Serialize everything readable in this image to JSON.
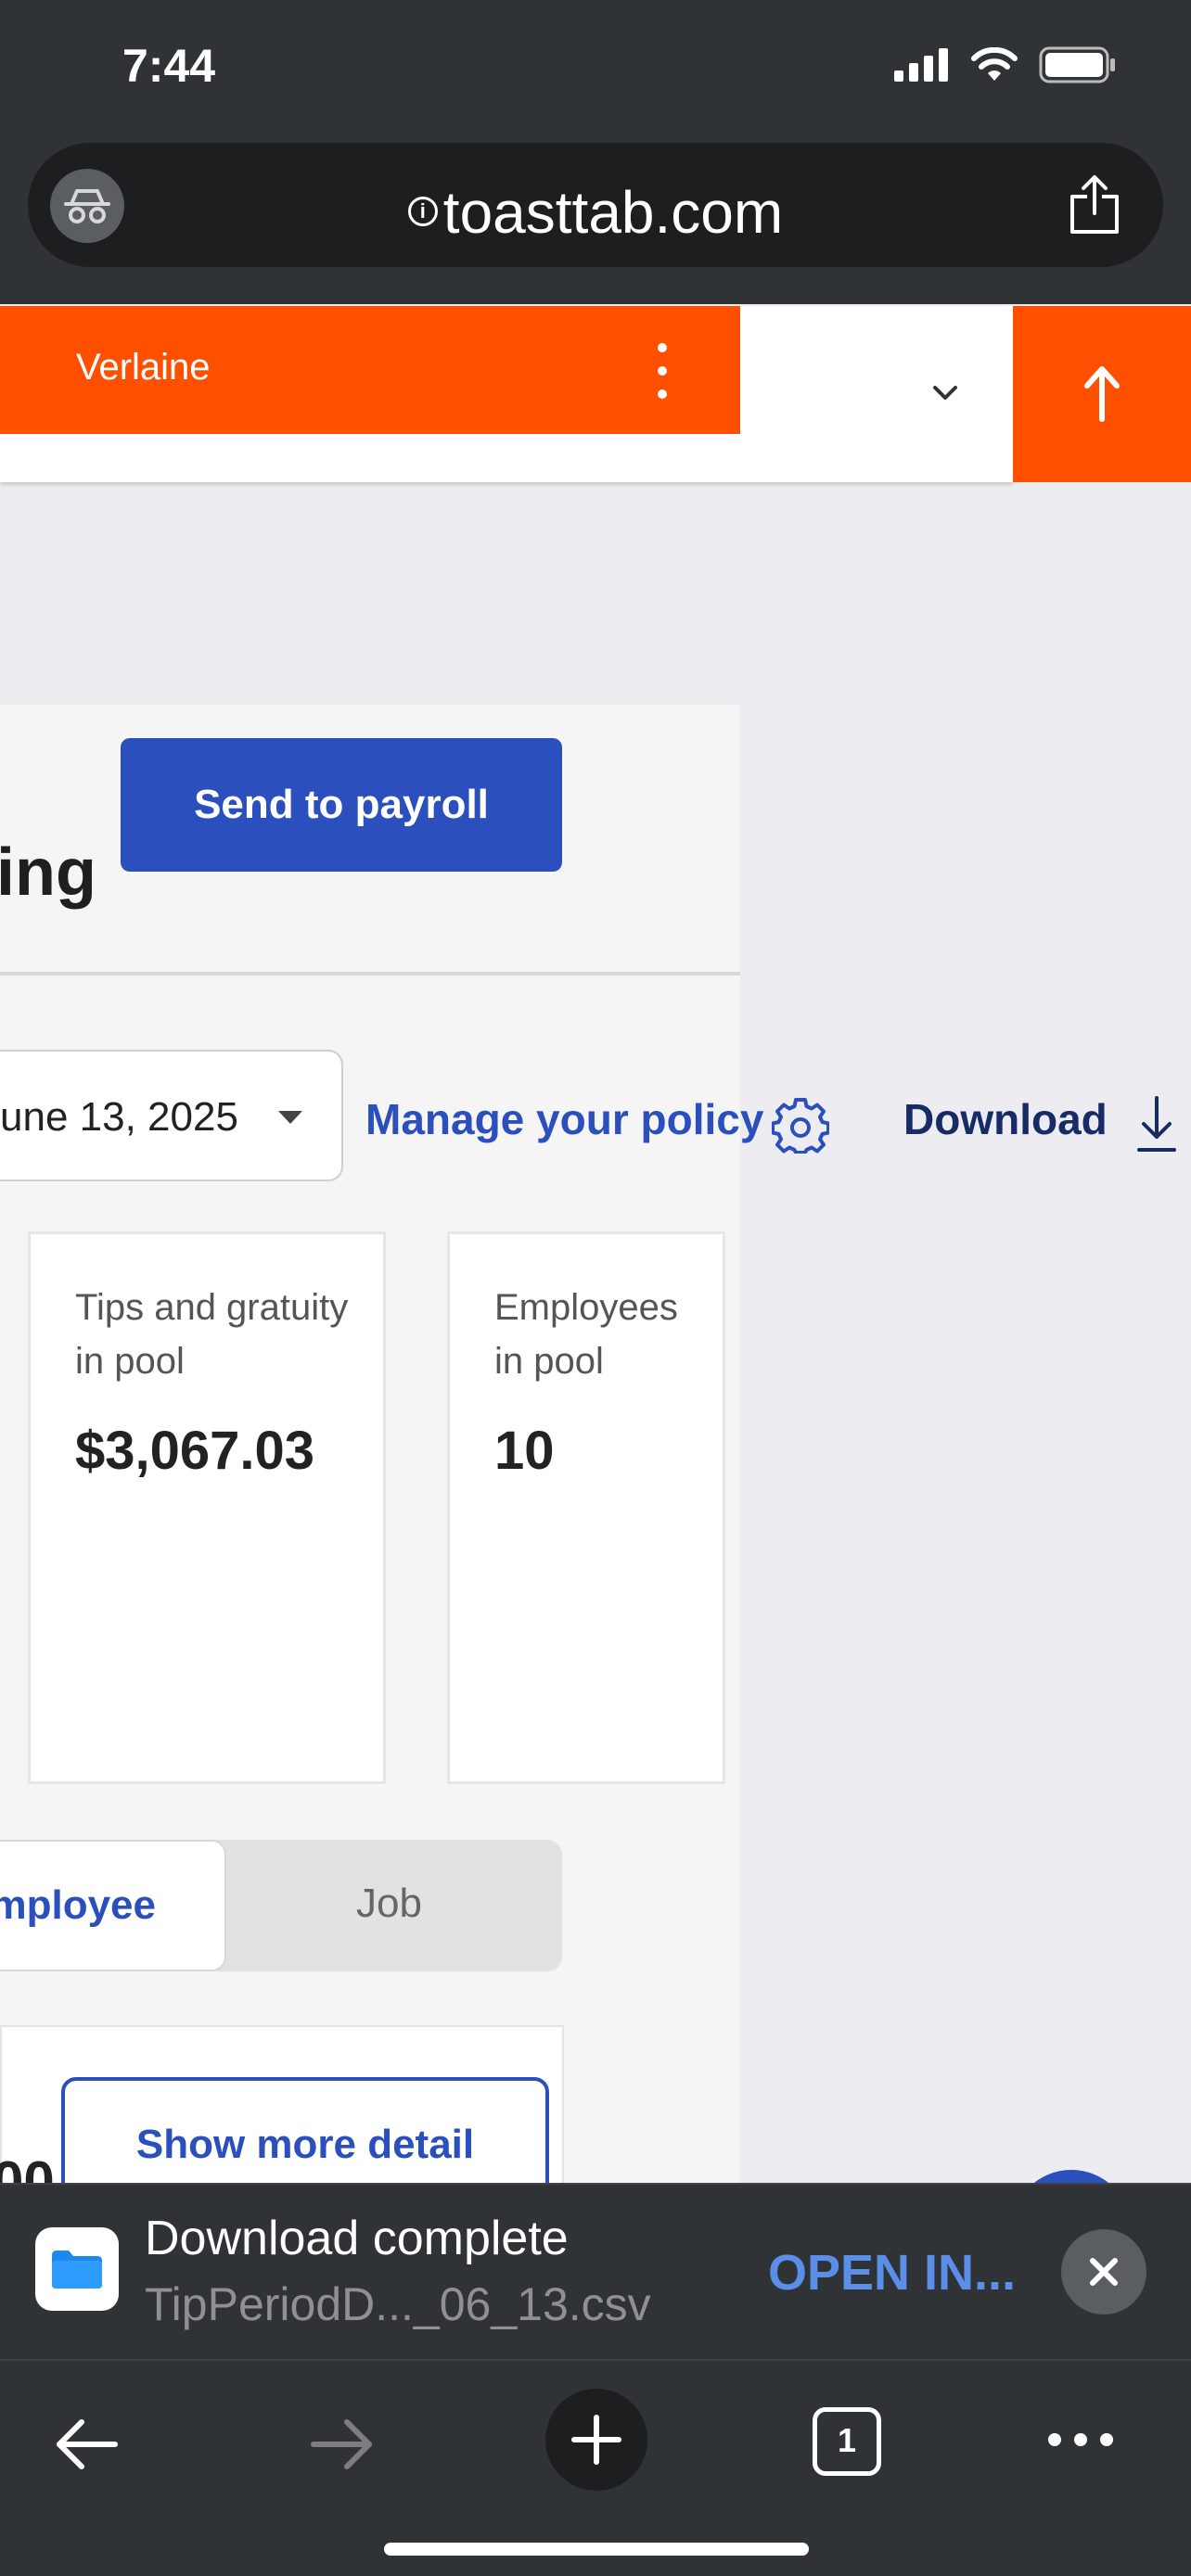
{
  "status_bar": {
    "time": "7:44",
    "icons": [
      "signal-icon",
      "wifi-icon",
      "battery-icon"
    ]
  },
  "browser": {
    "url": "toasttab.com",
    "icons": [
      "incognito-icon",
      "info-icon",
      "share-icon"
    ]
  },
  "header": {
    "restaurant": "Verlaine",
    "icons": [
      "kebab-menu-icon",
      "chevron-down-icon",
      "scroll-up-arrow-icon"
    ]
  },
  "main": {
    "heading_partial": "ing",
    "send_to_payroll_label": "Send to payroll",
    "date_value": "une 13, 2025",
    "manage_policy_label": "Manage your policy",
    "download_label": "Download",
    "stats": [
      {
        "label": "Tips and gratuity in pool",
        "value": "$3,067.03"
      },
      {
        "label": "Employees in pool",
        "value": "10"
      }
    ],
    "toggle": {
      "employee_label": "mployee",
      "job_label": "Job"
    },
    "show_more_label": "Show more detail",
    "partial_value": "00"
  },
  "download_banner": {
    "title": "Download complete",
    "filename": "TipPeriodD..._06_13.csv",
    "open_in_label": "OPEN IN...",
    "icons": [
      "files-app-icon",
      "close-icon"
    ]
  },
  "toolbar": {
    "tab_count": "1",
    "icons": [
      "back-arrow-icon",
      "forward-arrow-icon",
      "new-tab-plus-icon",
      "tabs-icon",
      "more-icon"
    ]
  },
  "colors": {
    "brand_orange": "#ff4f00",
    "primary_blue": "#2b4fbd",
    "chrome_dark": "#303336",
    "link_blue": "#5b8ee8"
  }
}
